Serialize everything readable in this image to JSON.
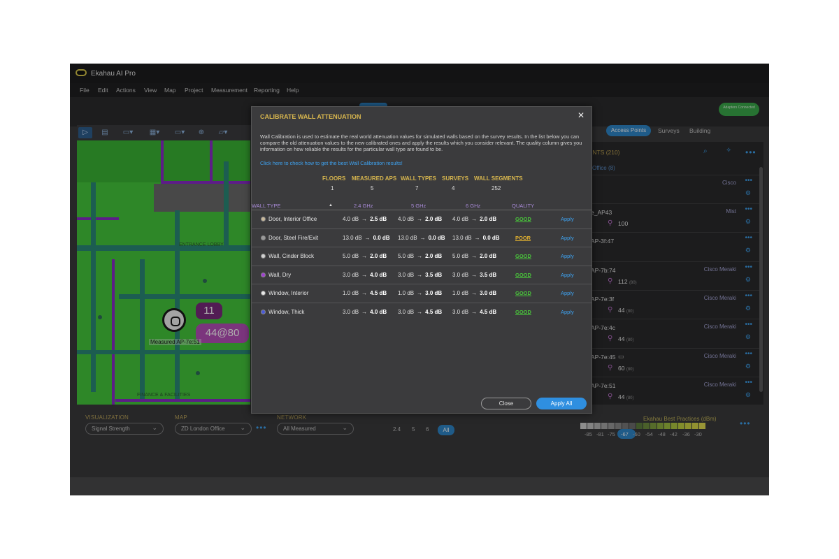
{
  "app": {
    "title": "Ekahau AI Pro"
  },
  "menu": [
    "File",
    "Edit",
    "Actions",
    "View",
    "Map",
    "Project",
    "Measurement",
    "Reporting",
    "Help"
  ],
  "header": {
    "adapter_badge": "Adapters Connected"
  },
  "map": {
    "ap_bubble_count": "11",
    "ap_bubble_signal": "44@80",
    "ap_label": "Measured AP-7e:51",
    "labels": {
      "entrance": "ENTRANCE LOBBY",
      "finance": "FINANCE & FACILITIES"
    }
  },
  "controls": {
    "visualization_label": "VISUALIZATION",
    "visualization_value": "Signal Strength",
    "map_label": "MAP",
    "map_value": "ZD London Office",
    "network_label": "NETWORK",
    "network_value": "All Measured",
    "bands": [
      "2.4",
      "5",
      "6"
    ],
    "band_all": "All"
  },
  "right_panel": {
    "tabs": {
      "access_points": "Access Points",
      "surveys": "Surveys",
      "building": "Building"
    },
    "heading": "INTS (210)",
    "subheading": "Office (8)",
    "items": [
      {
        "name": "",
        "vendor": "Cisco",
        "signal": "",
        "sub": ""
      },
      {
        "name": "e_AP43",
        "vendor": "Mist",
        "signal": "100",
        "sub": ""
      },
      {
        "name": "AP-3f:47",
        "vendor": "",
        "signal": "",
        "sub": ""
      },
      {
        "name": "AP-7b:74",
        "vendor": "Cisco Meraki",
        "signal": "112",
        "sub": "(80)"
      },
      {
        "name": "AP-7e:3f",
        "vendor": "Cisco Meraki",
        "signal": "44",
        "sub": "(80)"
      },
      {
        "name": "AP-7e:4c",
        "vendor": "Cisco Meraki",
        "signal": "44",
        "sub": "(80)"
      },
      {
        "name": "AP-7e:45",
        "vendor": "Cisco Meraki",
        "signal": "60",
        "sub": "(80)"
      },
      {
        "name": "AP-7e:51",
        "vendor": "Cisco Meraki",
        "signal": "44",
        "sub": "(80)"
      }
    ],
    "legend_title": "Ekahau Best Practices (dBm)",
    "legend_values": [
      "-85",
      "-81",
      "-75",
      "-67",
      "-60",
      "-54",
      "-48",
      "-42",
      "-36",
      "-30"
    ]
  },
  "dialog": {
    "title": "CALIBRATE WALL ATTENUATION",
    "description": "Wall Calibration is used to estimate the real world attenuation values for simulated walls based on the survey results. In the list below you can compare the old attenuation values to the new calibrated ones and apply the results which you consider relevant. The quality column gives you information on how reliable the results for the particular wall type are found to be.",
    "link": "Click here to check how to get the best Wall Calibration results!",
    "stats": [
      {
        "label": "FLOORS",
        "value": "1"
      },
      {
        "label": "MEASURED APS",
        "value": "5"
      },
      {
        "label": "WALL TYPES",
        "value": "7"
      },
      {
        "label": "SURVEYS",
        "value": "4"
      },
      {
        "label": "WALL SEGMENTS",
        "value": "252"
      }
    ],
    "columns": {
      "wall_type": "WALL TYPE",
      "g24": "2.4 GHz",
      "g5": "5 GHz",
      "g6": "6 GHz",
      "quality": "QUALITY"
    },
    "rows": [
      {
        "name": "Door, Interior Office",
        "dot": "#c8b89a",
        "g24_old": "4.0 dB",
        "g24_new": "2.5 dB",
        "g5_old": "4.0 dB",
        "g5_new": "2.0 dB",
        "g6_old": "4.0 dB",
        "g6_new": "2.0 dB",
        "quality": "GOOD",
        "quality_color": "#49c43b",
        "apply": "Apply"
      },
      {
        "name": "Door, Steel Fire/Exit",
        "dot": "#9a9a9a",
        "g24_old": "13.0 dB",
        "g24_new": "0.0 dB",
        "g5_old": "13.0 dB",
        "g5_new": "0.0 dB",
        "g6_old": "13.0 dB",
        "g6_new": "0.0 dB",
        "quality": "POOR",
        "quality_color": "#e0b030",
        "apply": "Apply"
      },
      {
        "name": "Wall, Cinder Block",
        "dot": "#d0d0d0",
        "g24_old": "5.0 dB",
        "g24_new": "2.0 dB",
        "g5_old": "5.0 dB",
        "g5_new": "2.0 dB",
        "g6_old": "5.0 dB",
        "g6_new": "2.0 dB",
        "quality": "GOOD",
        "quality_color": "#49c43b",
        "apply": "Apply"
      },
      {
        "name": "Wall, Dry",
        "dot": "#a040d0",
        "g24_old": "3.0 dB",
        "g24_new": "4.0 dB",
        "g5_old": "3.0 dB",
        "g5_new": "3.5 dB",
        "g6_old": "3.0 dB",
        "g6_new": "3.5 dB",
        "quality": "GOOD",
        "quality_color": "#49c43b",
        "apply": "Apply"
      },
      {
        "name": "Window, Interior",
        "dot": "#e8e8e8",
        "g24_old": "1.0 dB",
        "g24_new": "4.5 dB",
        "g5_old": "1.0 dB",
        "g5_new": "3.0 dB",
        "g6_old": "1.0 dB",
        "g6_new": "3.0 dB",
        "quality": "GOOD",
        "quality_color": "#49c43b",
        "apply": "Apply"
      },
      {
        "name": "Window, Thick",
        "dot": "#4a5ad8",
        "g24_old": "3.0 dB",
        "g24_new": "4.0 dB",
        "g5_old": "3.0 dB",
        "g5_new": "4.5 dB",
        "g6_old": "3.0 dB",
        "g6_new": "4.5 dB",
        "quality": "GOOD",
        "quality_color": "#49c43b",
        "apply": "Apply"
      }
    ],
    "arrow": "→",
    "buttons": {
      "close": "Close",
      "apply_all": "Apply All"
    }
  }
}
